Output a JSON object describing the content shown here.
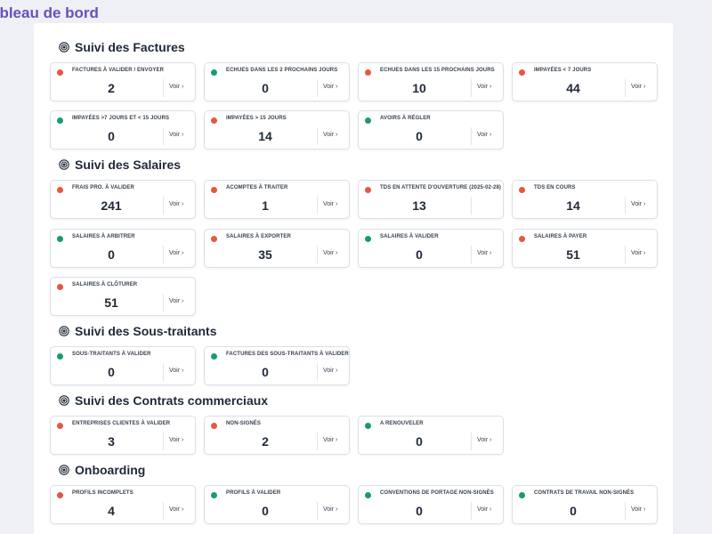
{
  "page_title": "ableau de bord",
  "colors": {
    "red": "#e8573f",
    "green": "#1a9c6a",
    "title": "#6b4fbb"
  },
  "sections": [
    {
      "title": "Suivi des Factures",
      "cards": [
        {
          "label": "FACTURES À VALIDER / ENVOYER",
          "value": "2",
          "status": "red",
          "link": "Voir ›"
        },
        {
          "label": "ECHUES DANS LES 2 PROCHAINS JOURS",
          "value": "0",
          "status": "green",
          "link": "Voir ›"
        },
        {
          "label": "ECHUES DANS LES 15 PROCHAINS JOURS",
          "value": "10",
          "status": "red",
          "link": "Voir ›"
        },
        {
          "label": "IMPAYÉES < 7 JOURS",
          "value": "44",
          "status": "red",
          "link": "Voir ›"
        },
        {
          "label": "IMPAYÉES >7 JOURS ET < 15 JOURS",
          "value": "0",
          "status": "green",
          "link": "Voir ›"
        },
        {
          "label": "IMPAYÉES > 15 JOURS",
          "value": "14",
          "status": "red",
          "link": "Voir ›"
        },
        {
          "label": "AVOIRS À RÉGLER",
          "value": "0",
          "status": "green",
          "link": "Voir ›"
        }
      ]
    },
    {
      "title": "Suivi des Salaires",
      "cards": [
        {
          "label": "FRAIS PRO. À VALIDER",
          "value": "241",
          "status": "red",
          "link": "Voir ›"
        },
        {
          "label": "ACOMPTES À TRAITER",
          "value": "1",
          "status": "red",
          "link": "Voir ›"
        },
        {
          "label": "TDS EN ATTENTE D'OUVERTURE (2025-02-28)",
          "value": "13",
          "status": "red",
          "link": ""
        },
        {
          "label": "TDS EN COURS",
          "value": "14",
          "status": "red",
          "link": "Voir ›"
        },
        {
          "label": "SALAIRES À ARBITRER",
          "value": "0",
          "status": "green",
          "link": "Voir ›"
        },
        {
          "label": "SALAIRES À EXPORTER",
          "value": "35",
          "status": "red",
          "link": "Voir ›"
        },
        {
          "label": "SALAIRES À VALIDER",
          "value": "0",
          "status": "green",
          "link": "Voir ›"
        },
        {
          "label": "SALAIRES À PAYER",
          "value": "51",
          "status": "red",
          "link": "Voir ›"
        },
        {
          "label": "SALAIRES À CLÔTURER",
          "value": "51",
          "status": "red",
          "link": "Voir ›"
        }
      ]
    },
    {
      "title": "Suivi des Sous-traitants",
      "cards": [
        {
          "label": "SOUS-TRAITANTS À VALIDER",
          "value": "0",
          "status": "green",
          "link": "Voir ›"
        },
        {
          "label": "FACTURES DES SOUS-TRAITANTS À VALIDER",
          "value": "0",
          "status": "green",
          "link": "Voir ›"
        }
      ]
    },
    {
      "title": "Suivi des Contrats commerciaux",
      "cards": [
        {
          "label": "ENTREPRISES CLIENTES À VALIDER",
          "value": "3",
          "status": "red",
          "link": "Voir ›"
        },
        {
          "label": "NON-SIGNÉS",
          "value": "2",
          "status": "red",
          "link": "Voir ›"
        },
        {
          "label": "A RENOUVELER",
          "value": "0",
          "status": "green",
          "link": "Voir ›"
        }
      ]
    },
    {
      "title": "Onboarding",
      "cards": [
        {
          "label": "PROFILS INCOMPLETS",
          "value": "4",
          "status": "red",
          "link": "Voir ›"
        },
        {
          "label": "PROFILS À VALIDER",
          "value": "0",
          "status": "green",
          "link": "Voir ›"
        },
        {
          "label": "CONVENTIONS DE PORTAGE NON-SIGNÉS",
          "value": "0",
          "status": "green",
          "link": "Voir ›"
        },
        {
          "label": "CONTRATS DE TRAVAIL NON-SIGNÉS",
          "value": "0",
          "status": "green",
          "link": "Voir ›"
        }
      ]
    }
  ]
}
